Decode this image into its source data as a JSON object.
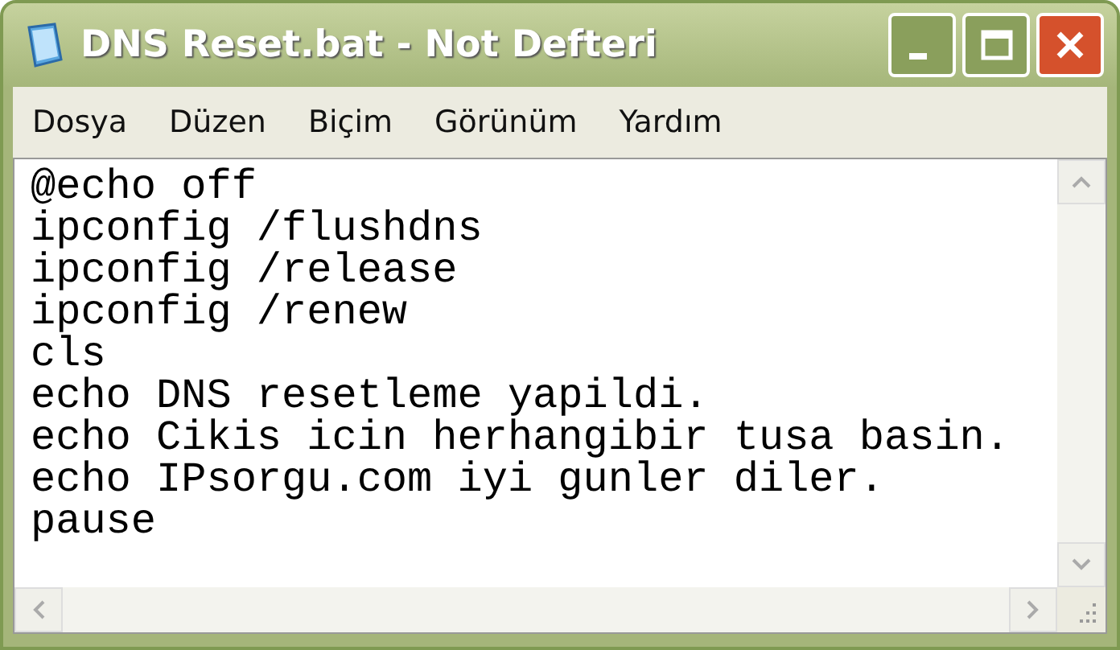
{
  "window": {
    "title": "DNS Reset.bat - Not Defteri"
  },
  "menu": [
    {
      "label": "Dosya"
    },
    {
      "label": "Düzen"
    },
    {
      "label": "Biçim"
    },
    {
      "label": "Görünüm"
    },
    {
      "label": "Yardım"
    }
  ],
  "editor": {
    "lines": [
      "@echo off",
      "ipconfig /flushdns",
      "ipconfig /release",
      "ipconfig /renew",
      "cls",
      "echo DNS resetleme yapildi.",
      "echo Cikis icin herhangibir tusa basin.",
      "echo IPsorgu.com iyi gunler diler.",
      "pause"
    ]
  }
}
